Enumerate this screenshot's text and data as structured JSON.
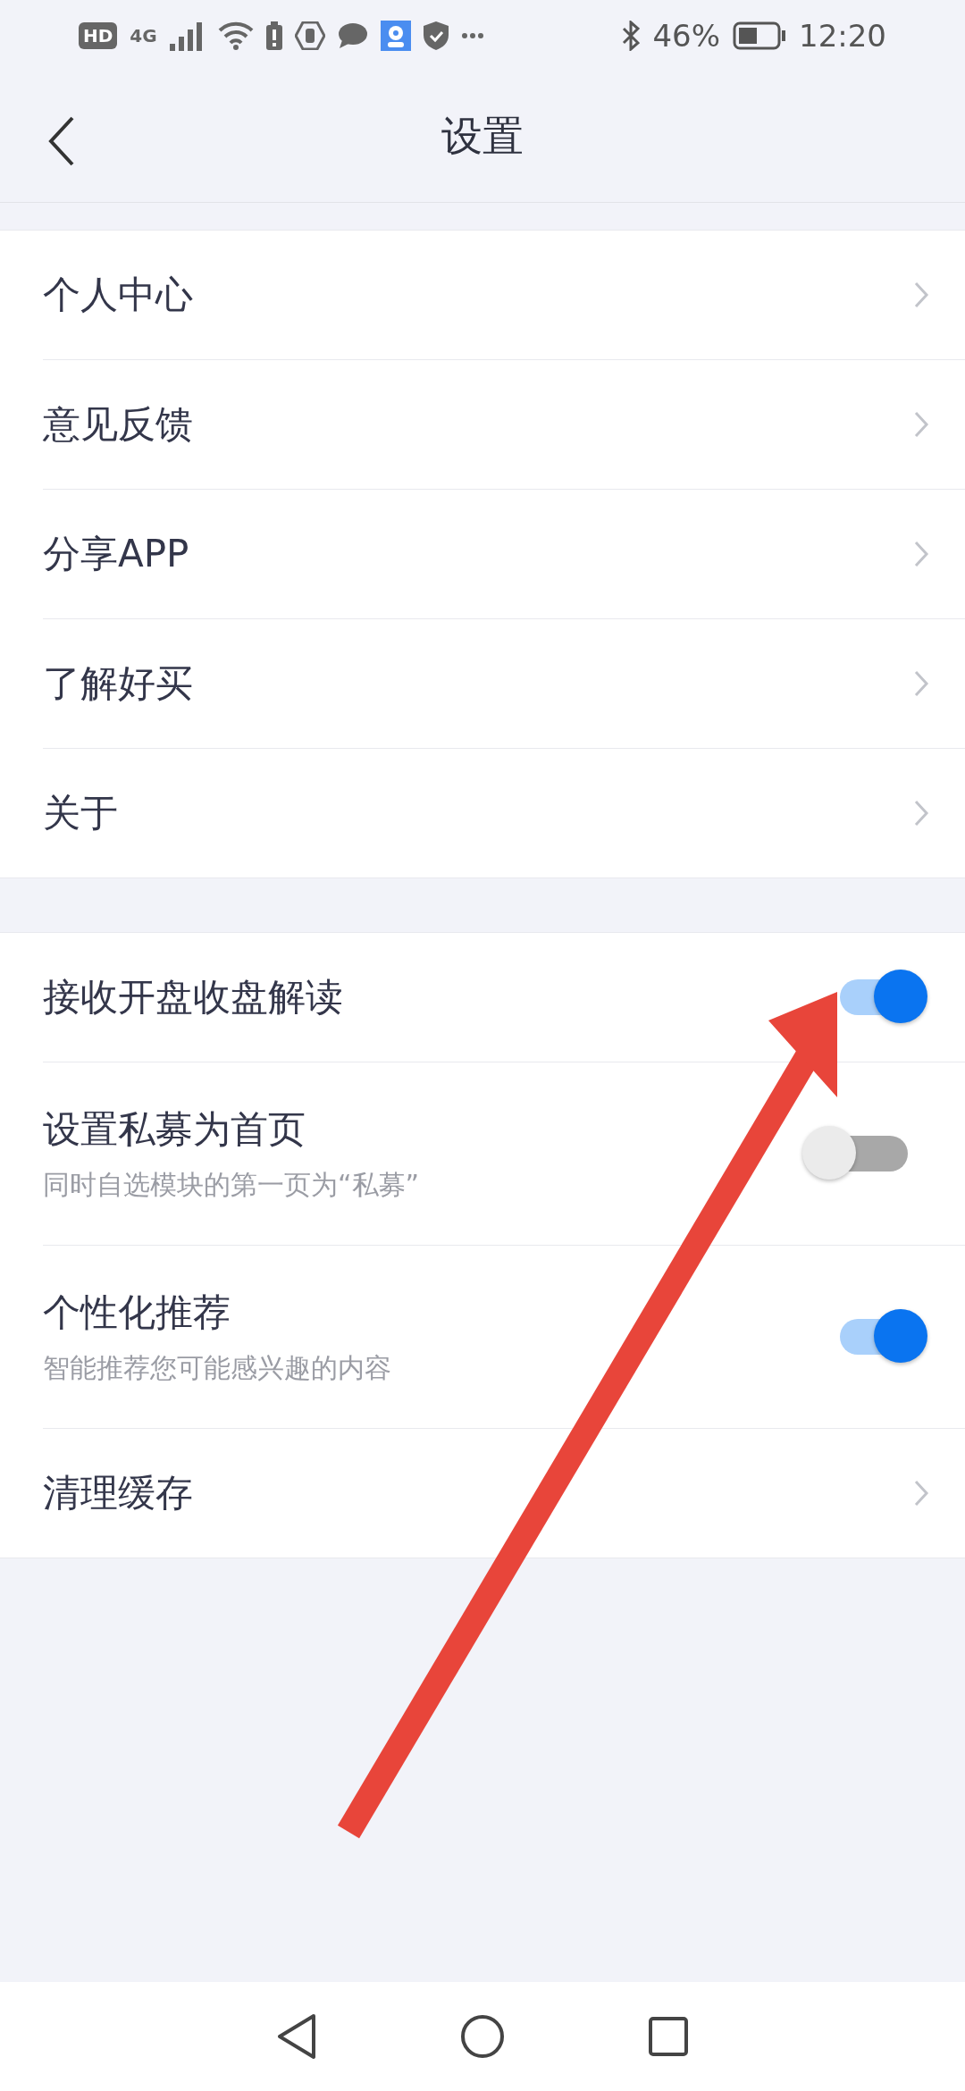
{
  "status_bar": {
    "hd": "HD",
    "network": "4G",
    "battery_text": "46%",
    "time": "12:20"
  },
  "header": {
    "title": "设置"
  },
  "groups": [
    {
      "items": [
        {
          "kind": "link",
          "label": "个人中心"
        },
        {
          "kind": "link",
          "label": "意见反馈"
        },
        {
          "kind": "link",
          "label": "分享APP"
        },
        {
          "kind": "link",
          "label": "了解好买"
        },
        {
          "kind": "link",
          "label": "关于"
        }
      ]
    },
    {
      "items": [
        {
          "kind": "toggle",
          "label": "接收开盘收盘解读",
          "on": true
        },
        {
          "kind": "toggle",
          "label": "设置私募为首页",
          "subtitle": "同时自选模块的第一页为“私募”",
          "on": false
        },
        {
          "kind": "toggle",
          "label": "个性化推荐",
          "subtitle": "智能推荐您可能感兴趣的内容",
          "on": true
        },
        {
          "kind": "link",
          "label": "清理缓存"
        }
      ]
    }
  ]
}
